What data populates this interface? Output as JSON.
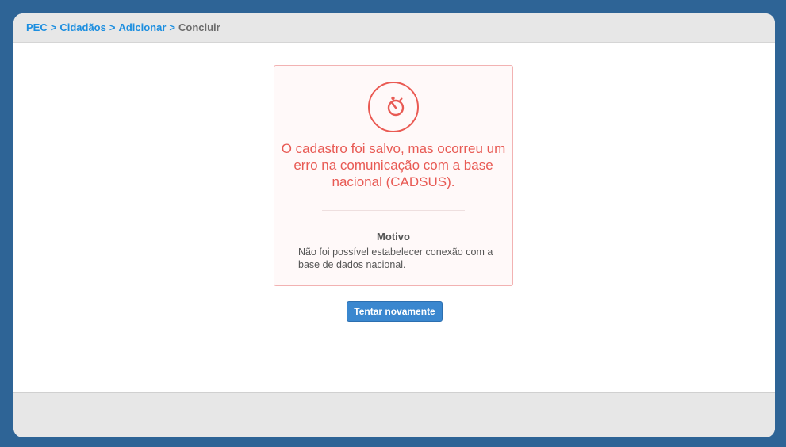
{
  "breadcrumb": {
    "items": [
      {
        "label": "PEC"
      },
      {
        "label": "Cidadãos"
      },
      {
        "label": "Adicionar"
      }
    ],
    "separator": ">",
    "current": "Concluir"
  },
  "error_card": {
    "icon": "stopwatch-icon",
    "message": "O cadastro foi salvo, mas ocorreu um erro na comunicação com a base nacional (CADSUS).",
    "reason_title": "Motivo",
    "reason_text": "Não foi possível estabelecer conexão com a base de dados nacional."
  },
  "actions": {
    "retry_label": "Tentar novamente"
  },
  "colors": {
    "background": "#2e6496",
    "error": "#e85a54",
    "link": "#1b8ee0",
    "button": "#3a87cf"
  }
}
